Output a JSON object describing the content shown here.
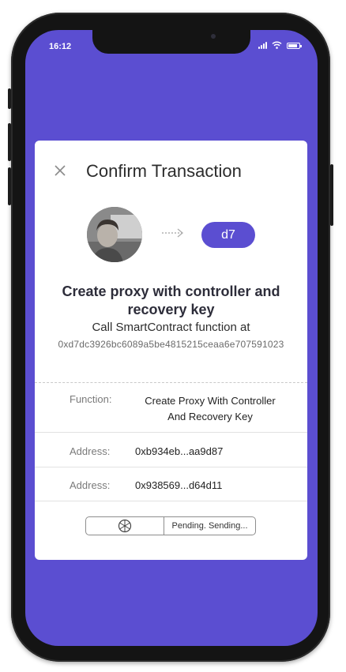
{
  "status_bar": {
    "time": "16:12"
  },
  "dialog": {
    "title": "Confirm Transaction",
    "recipient_badge": "d7",
    "heading": "Create proxy with controller and recovery key",
    "subtitle": "Call SmartContract function at",
    "contract_address": "0xd7dc3926bc6089a5be4815215ceaa6e707591023",
    "rows": [
      {
        "label": "Function:",
        "value": "Create Proxy With Controller And Recovery Key"
      },
      {
        "label": "Address:",
        "value": "0xb934eb...aa9d87"
      },
      {
        "label": "Address:",
        "value": "0x938569...d64d11"
      }
    ],
    "pending_text": "Pending.  Sending..."
  },
  "icons": {
    "close": "close-icon",
    "arrow": "arrow-right-icon",
    "spinner": "spinner-icon",
    "signal": "signal-icon",
    "wifi": "wifi-icon",
    "battery": "battery-icon"
  },
  "colors": {
    "accent": "#5b4ed1",
    "card": "#ffffff",
    "frame": "#141414"
  }
}
